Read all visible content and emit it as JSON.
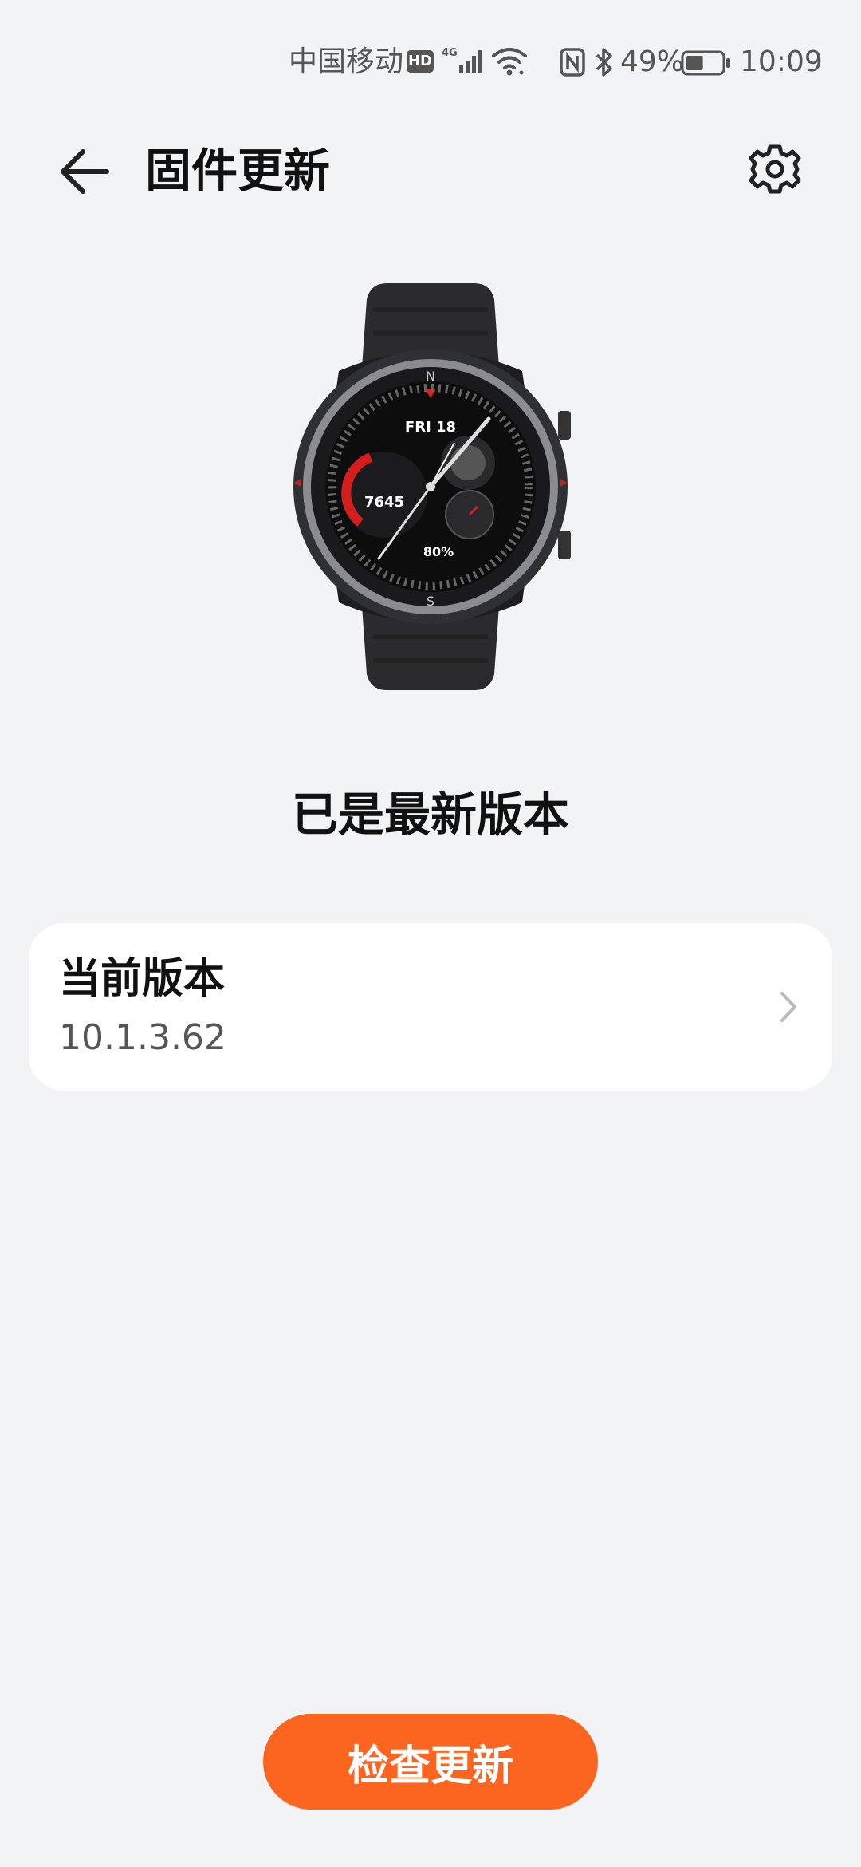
{
  "status_bar": {
    "carrier": "中国移动",
    "hd_badge": "HD",
    "network": "4G",
    "battery_percent": "49%",
    "battery_level": 0.49,
    "time": "10:09",
    "icons": [
      "signal-icon",
      "wifi-icon",
      "nfc-icon",
      "bluetooth-icon",
      "battery-icon"
    ]
  },
  "header": {
    "title": "固件更新",
    "back_icon": "back-arrow-icon",
    "settings_icon": "gear-icon"
  },
  "watch_face": {
    "date": "FRI 18",
    "steps": "7645",
    "battery": "80%",
    "compass_n": "N",
    "compass_s": "S"
  },
  "status_message": "已是最新版本",
  "version_card": {
    "title": "当前版本",
    "value": "10.1.3.62"
  },
  "actions": {
    "check_update": "检查更新"
  },
  "colors": {
    "accent": "#fb6520",
    "background": "#f1f3f5",
    "card": "#ffffff"
  }
}
